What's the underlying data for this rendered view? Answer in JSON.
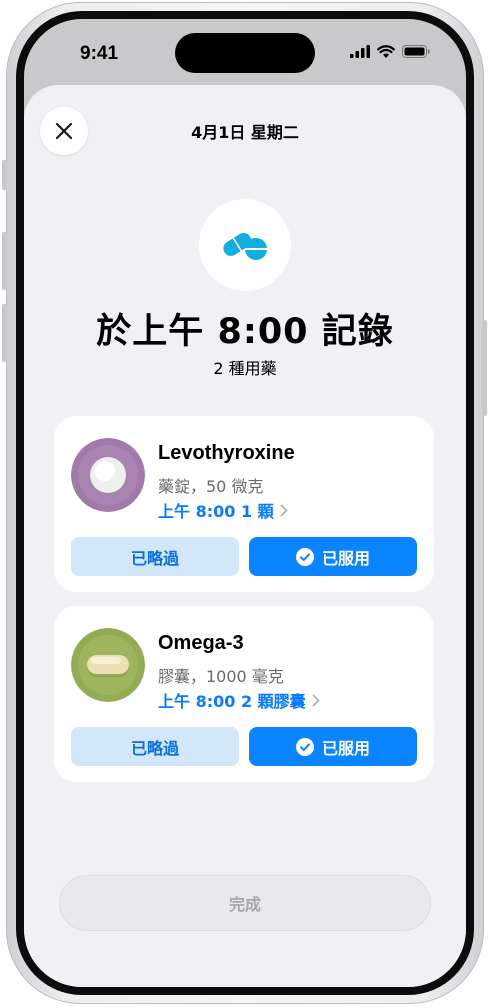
{
  "status_bar": {
    "time": "9:41"
  },
  "sheet": {
    "date_title": "4月1日 星期二",
    "headline": "於上午 8:00 記錄",
    "subline": "2 種用藥"
  },
  "medications": [
    {
      "name": "Levothyroxine",
      "detail": "藥錠，50 微克",
      "schedule": "上午 8:00 1 顆",
      "skip_label": "已略過",
      "taken_label": "已服用",
      "image_color": "#a07aa8"
    },
    {
      "name": "Omega-3",
      "detail": "膠囊，1000 毫克",
      "schedule": "上午 8:00 2 顆膠囊",
      "skip_label": "已略過",
      "taken_label": "已服用",
      "image_color": "#93ad55"
    }
  ],
  "footer": {
    "done_label": "完成"
  },
  "colors": {
    "accent": "#0a84ff",
    "accent_light": "#d3e7fb",
    "sheet_bg": "#f1f1f5",
    "pill_icon": "#12aee0"
  },
  "icons": {
    "close": "close-icon",
    "pill": "pills-icon",
    "checkmark": "checkmark-circle-icon",
    "chevron": "chevron-right-icon"
  }
}
